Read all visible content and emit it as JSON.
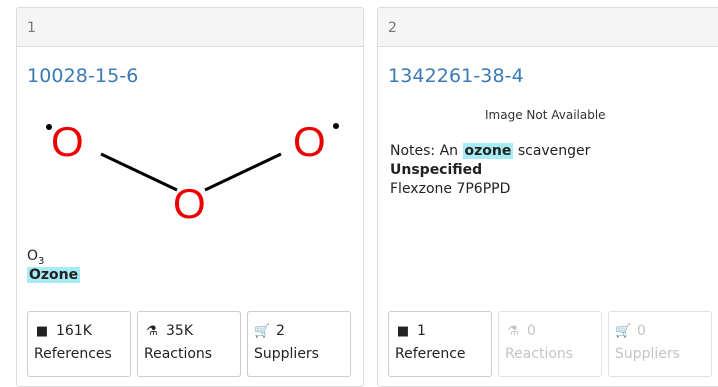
{
  "cards": [
    {
      "index": "1",
      "cas": "10028-15-6",
      "formula_base": "O",
      "formula_sub": "3",
      "name": "Ozone",
      "atom_label": "O",
      "buttons": [
        {
          "icon": "book-icon",
          "count": "161K",
          "label": "References"
        },
        {
          "icon": "flask-icon",
          "count": "35K",
          "label": "Reactions"
        },
        {
          "icon": "cart-icon",
          "count": "2",
          "label": "Suppliers"
        }
      ]
    },
    {
      "index": "2",
      "cas": "1342261-38-4",
      "image_status": "Image Not Available",
      "notes_prefix": "Notes: An ",
      "notes_highlight": "ozone",
      "notes_suffix": " scavenger",
      "notes_bold": "Unspecified",
      "notes_extra": "Flexzone 7P6PPD",
      "buttons": [
        {
          "icon": "book-icon",
          "count": "1",
          "label": "Reference"
        },
        {
          "icon": "flask-icon",
          "count": "0",
          "label": "Reactions"
        },
        {
          "icon": "cart-icon",
          "count": "0",
          "label": "Suppliers"
        }
      ]
    }
  ],
  "colors": {
    "link": "#3a7ab8",
    "highlight": "#a7ebf4",
    "atom": "#ee0000"
  }
}
